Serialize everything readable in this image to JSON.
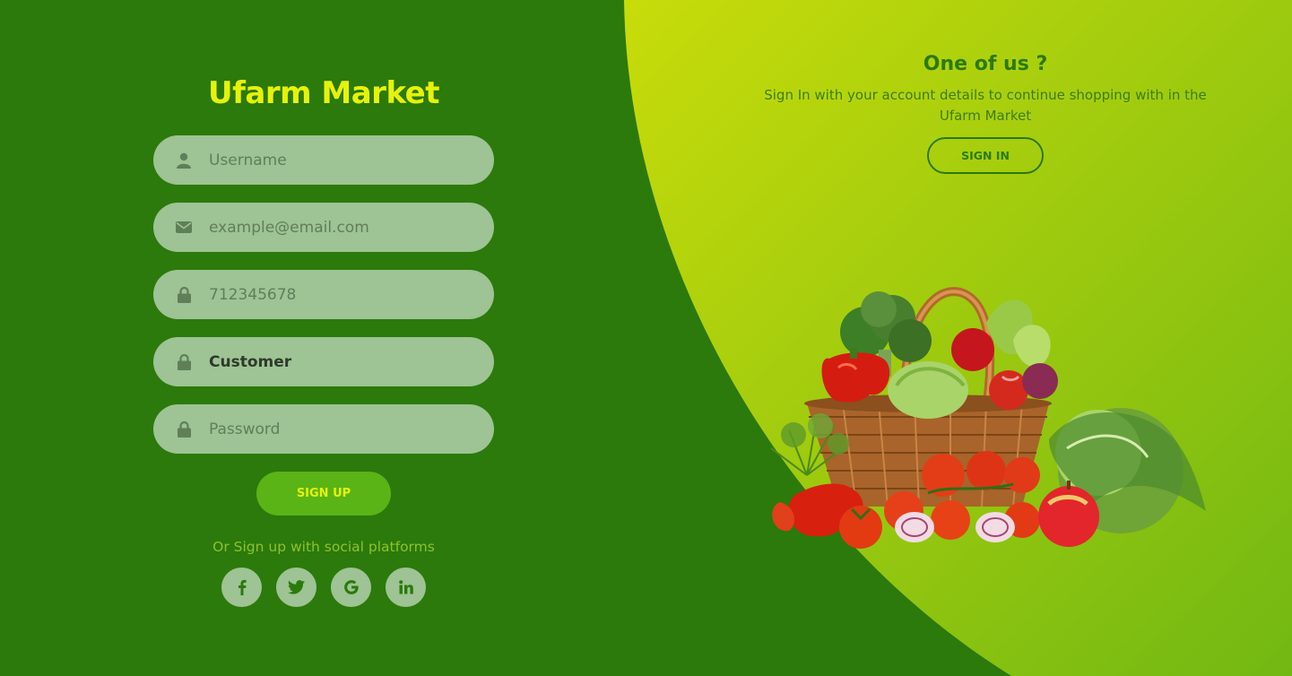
{
  "signup": {
    "title": "Ufarm Market",
    "fields": {
      "username": {
        "placeholder": "Username",
        "value": "",
        "icon": "user-icon"
      },
      "email": {
        "placeholder": "example@email.com",
        "value": "",
        "icon": "envelope-icon"
      },
      "phone": {
        "placeholder": "712345678",
        "value": "",
        "icon": "lock-icon"
      },
      "role": {
        "placeholder": "",
        "value": "Customer",
        "icon": "lock-icon"
      },
      "password": {
        "placeholder": "Password",
        "value": "",
        "icon": "lock-icon"
      }
    },
    "button_label": "SIGN UP",
    "social_text": "Or Sign up with social platforms",
    "social": [
      "facebook-icon",
      "twitter-icon",
      "google-icon",
      "linkedin-icon"
    ]
  },
  "signin": {
    "title": "One of us ?",
    "description": "Sign In with your account details to continue shopping with in the Ufarm Market",
    "button_label": "SIGN IN"
  },
  "colors": {
    "background": "#2b7a0b",
    "accent_gradient_start": "#c6db0a",
    "accent_gradient_end": "#77bb14",
    "title_yellow": "#e7f20a",
    "input_fill": "#9ec394",
    "signup_button": "#5ab416"
  },
  "illustration": "vegetable-basket-image"
}
